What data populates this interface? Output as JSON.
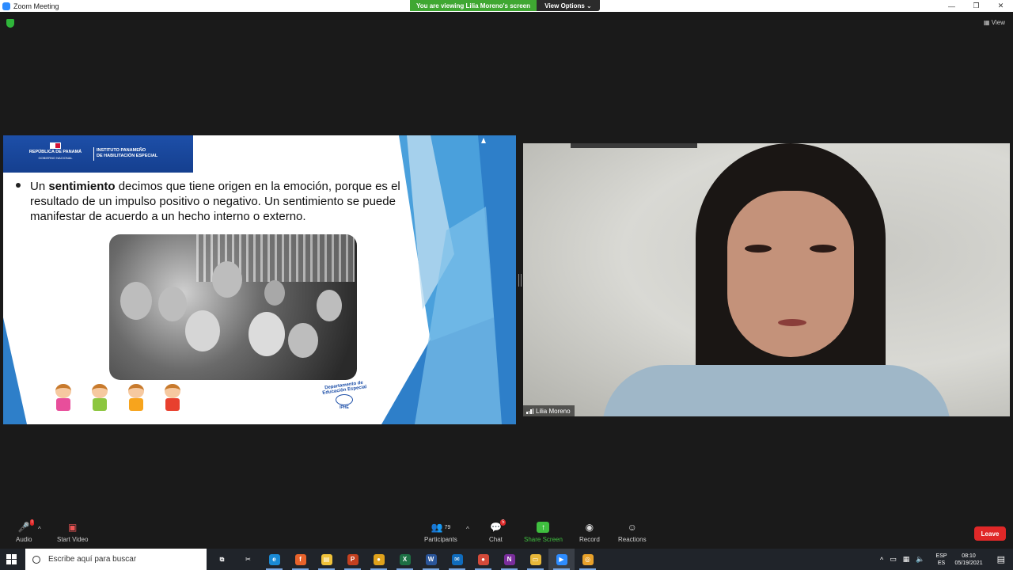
{
  "window": {
    "title": "Zoom Meeting",
    "minimize": "—",
    "maximize": "❐",
    "close": "✕"
  },
  "banner": {
    "viewing": "You are viewing Lilia Moreno's screen",
    "view_options": "View Options ⌄"
  },
  "top_right": {
    "view": "▦ View"
  },
  "slide": {
    "header_left_line1": "REPÚBLICA DE PANAMÁ",
    "header_left_line2": "GOBIERNO NACIONAL",
    "header_right_line1": "INSTITUTO PANAMEÑO",
    "header_right_line2": "DE HABILITACIÓN ESPECIAL",
    "text_lead": "Un ",
    "text_bold": "sentimiento",
    "text_rest": " decimos que tiene origen en la emoción, porque es el resultado de un impulso positivo o negativo. Un sentimiento se puede manifestar de acuerdo a un hecho interno o externo.",
    "dept_logo": "Departamento de Educación Especial",
    "dept_logo_sub": "IPHE"
  },
  "participant": {
    "name": "Lilia Moreno"
  },
  "toolbar": {
    "audio": "Audio",
    "start_video": "Start Video",
    "participants": "Participants",
    "participants_count": "79",
    "chat": "Chat",
    "chat_badge": "5",
    "share_screen": "Share Screen",
    "record": "Record",
    "reactions": "Reactions",
    "leave": "Leave",
    "caret": "^"
  },
  "taskbar": {
    "search_placeholder": "Escribe aquí para buscar",
    "apps": [
      {
        "name": "task-view",
        "glyph": "⧉",
        "color": "#20242a"
      },
      {
        "name": "snip",
        "glyph": "✂",
        "color": "#20242a"
      },
      {
        "name": "edge",
        "glyph": "e",
        "color": "#1a8ad4"
      },
      {
        "name": "firefox",
        "glyph": "f",
        "color": "#e8632b"
      },
      {
        "name": "store",
        "glyph": "▤",
        "color": "#f0c23a"
      },
      {
        "name": "powerpoint",
        "glyph": "P",
        "color": "#c4401f"
      },
      {
        "name": "chrome",
        "glyph": "●",
        "color": "#e0a21b"
      },
      {
        "name": "excel",
        "glyph": "X",
        "color": "#1d7044"
      },
      {
        "name": "word",
        "glyph": "W",
        "color": "#2a5599"
      },
      {
        "name": "mail",
        "glyph": "✉",
        "color": "#0f6cbd"
      },
      {
        "name": "chrome-2",
        "glyph": "●",
        "color": "#d34a3a"
      },
      {
        "name": "onenote",
        "glyph": "N",
        "color": "#7a2d9c"
      },
      {
        "name": "explorer",
        "glyph": "▭",
        "color": "#e8b83a"
      },
      {
        "name": "zoom",
        "glyph": "▶",
        "color": "#2d8cff"
      },
      {
        "name": "other",
        "glyph": "◎",
        "color": "#e8a12a"
      }
    ],
    "lang_top": "ESP",
    "lang_bottom": "ES",
    "time": "08:10",
    "date": "05/19/2021"
  }
}
